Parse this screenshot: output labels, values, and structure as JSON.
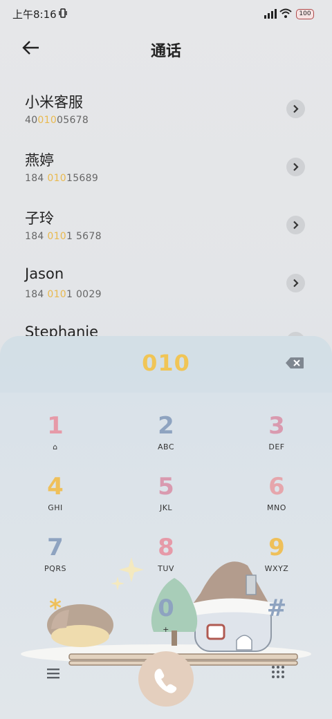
{
  "status": {
    "time": "上午8:16",
    "battery": "100"
  },
  "header": {
    "title": "通话"
  },
  "contacts": [
    {
      "name": "小米客服",
      "num_pre": "40",
      "num_hl": "010",
      "num_post": "05678"
    },
    {
      "name": "燕婷",
      "num_pre": "184 ",
      "num_hl": "010",
      "num_post": "15689"
    },
    {
      "name": "子玲",
      "num_pre": "184 ",
      "num_hl": "010",
      "num_post": "1 5678"
    },
    {
      "name": "Jason",
      "num_pre": "184 ",
      "num_hl": "010",
      "num_post": "1 0029"
    },
    {
      "name": "Stephanie",
      "num_pre": "",
      "num_hl": "",
      "num_post": ""
    }
  ],
  "dialer": {
    "typed": "010",
    "keys": [
      {
        "digit": "1",
        "letters": "⌂",
        "color": "#e69aa8"
      },
      {
        "digit": "2",
        "letters": "ABC",
        "color": "#8ea3c0"
      },
      {
        "digit": "3",
        "letters": "DEF",
        "color": "#d99aaf"
      },
      {
        "digit": "4",
        "letters": "GHI",
        "color": "#efc05a"
      },
      {
        "digit": "5",
        "letters": "JKL",
        "color": "#d99aaf"
      },
      {
        "digit": "6",
        "letters": "MNO",
        "color": "#e6a6ac"
      },
      {
        "digit": "7",
        "letters": "PQRS",
        "color": "#8ea3c0"
      },
      {
        "digit": "8",
        "letters": "TUV",
        "color": "#e69aa8"
      },
      {
        "digit": "9",
        "letters": "WXYZ",
        "color": "#efc05a"
      },
      {
        "digit": "*",
        "letters": "",
        "color": "#efc05a"
      },
      {
        "digit": "0",
        "letters": "+",
        "color": "#8ea3c0"
      },
      {
        "digit": "#",
        "letters": "",
        "color": "#8ea3c0"
      }
    ]
  },
  "colors": {
    "highlight": "#e9b94e",
    "call_button": "#e4cfbe"
  }
}
